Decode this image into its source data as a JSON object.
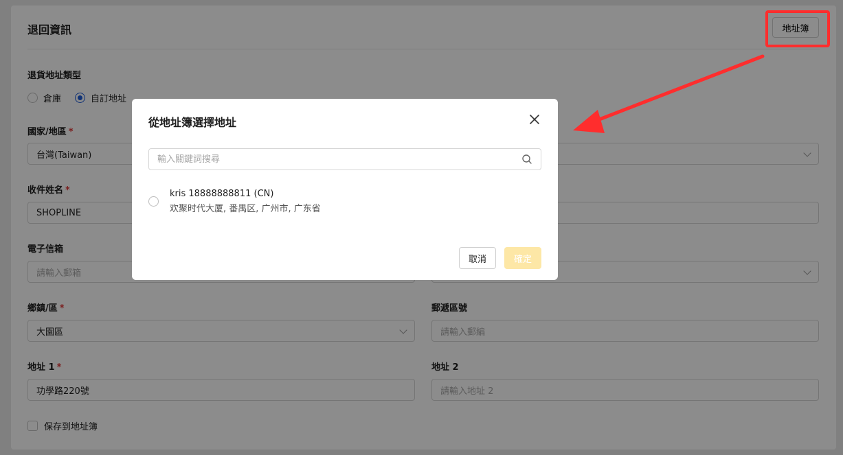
{
  "card": {
    "title": "退回資訊",
    "address_book_button": "地址簿",
    "type_label": "退貨地址類型",
    "radios": [
      "倉庫",
      "自訂地址"
    ],
    "country_label": "國家/地區",
    "country_value": "台灣(Taiwan)",
    "recipient_label": "收件姓名",
    "recipient_value": "SHOPLINE",
    "email_label": "電子信箱",
    "email_placeholder": "請輸入郵箱",
    "district_label": "鄉鎮/區",
    "district_value": "大園區",
    "zip_label": "郵遞區號",
    "zip_placeholder": "請輸入郵編",
    "address1_label": "地址 1",
    "address1_value": "功學路220號",
    "address2_label": "地址 2",
    "address2_placeholder": "請輸入地址 2",
    "save_checkbox_label": "保存到地址簿",
    "required_mark": "*"
  },
  "modal": {
    "title": "從地址簿選擇地址",
    "search_placeholder": "輸入關鍵詞搜尋",
    "items": [
      {
        "name": "kris 18888888811 (CN)",
        "detail": "欢聚时代大厦, 番禺区, 广州市, 广东省"
      }
    ],
    "cancel_label": "取消",
    "ok_label": "確定"
  },
  "colors": {
    "accent": "#1e5bd8",
    "highlight": "#ff2d2d",
    "ok_disabled": "#fde7a6",
    "required": "#e03a3a"
  }
}
